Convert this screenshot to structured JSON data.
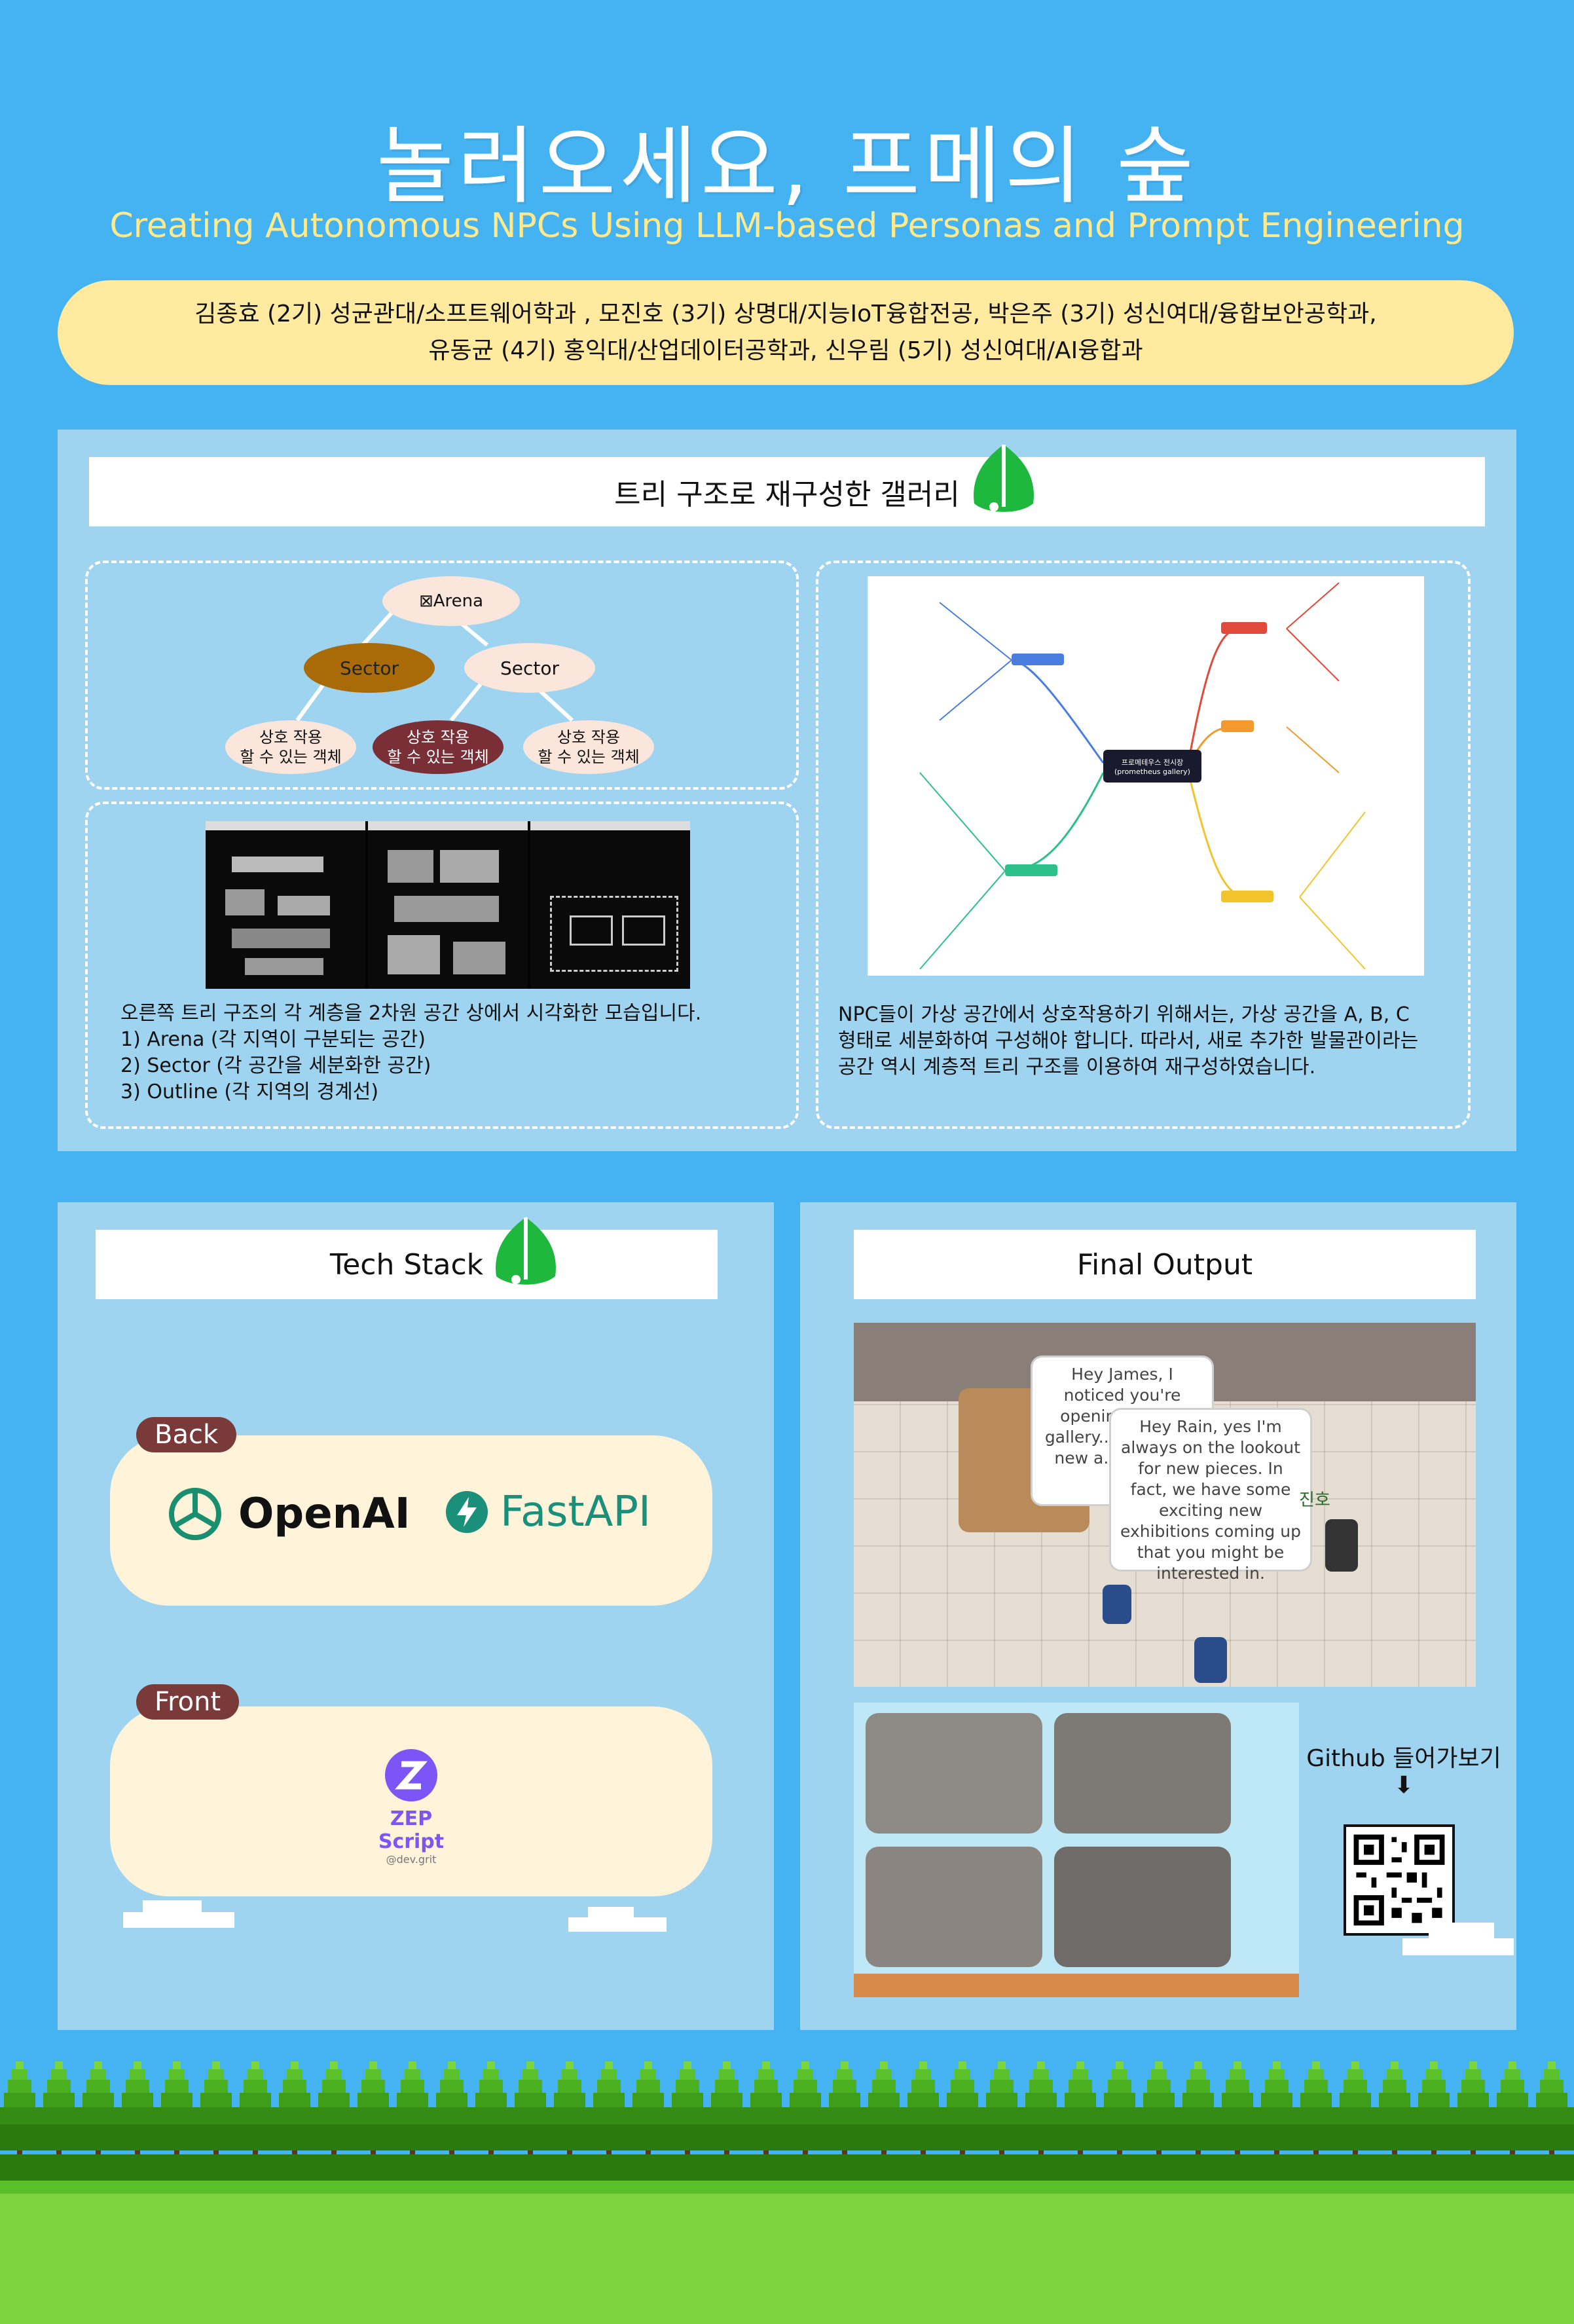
{
  "header": {
    "title": "놀러오세요, 프메의 숲",
    "subtitle": "Creating Autonomous NPCs Using LLM-based Personas and Prompt Engineering",
    "authors_line1": "김종효 (2기) 성균관대/소프트웨어학과 , 모진호 (3기) 상명대/지능IoT융합전공, 박은주 (3기) 성신여대/융합보안공학과,",
    "authors_line2": "유동균 (4기) 홍익대/산업데이터공학과, 신우림 (5기) 성신여대/AI융합과"
  },
  "gallery": {
    "title": "트리 구조로 재구성한 갤러리",
    "tree": {
      "root": "⊠Arena",
      "sector1": "Sector",
      "sector2": "Sector",
      "object1": "상호 작용\n할 수 있는 객체",
      "object2": "상호 작용\n할 수 있는 객체",
      "object3": "상호 작용\n할 수 있는 객체"
    },
    "left_caption": {
      "line1": "오른쪽 트리 구조의 각 계층을 2차원 공간 상에서 시각화한 모습입니다.",
      "line2": "1) Arena (각 지역이 구분되는 공간)",
      "line3": "2) Sector (각 공간을 세분화한 공간)",
      "line4": "3) Outline (각 지역의 경계선)"
    },
    "mindmap_center_line1": "프로메테우스 전시장",
    "mindmap_center_line2": "(prometheus gallery)",
    "right_caption": {
      "line1": "NPC들이 가상 공간에서 상호작용하기 위해서는, 가상 공간을 A, B, C",
      "line2": "형태로 세분화하여 구성해야 합니다. 따라서, 새로 추가한 발물관이라는",
      "line3": "공간 역시 계층적 트리 구조를 이용하여 재구성하였습니다."
    }
  },
  "tech": {
    "title": "Tech Stack",
    "back_label": "Back",
    "openai": "OpenAI",
    "fastapi": "FastAPI",
    "front_label": "Front",
    "zep": "ZEP Script",
    "zep_sub": "@dev.grit"
  },
  "output": {
    "title": "Final Output",
    "bubble1": "Hey James, I noticed you're opening up the gallery... you con... new a... caugh...",
    "bubble2": "Hey Rain, yes I'm always on the lookout for new pieces. In fact, we have some exciting new exhibitions coming up that you might be interested in.",
    "npc_name": "진호",
    "github_label": "Github 들어가보기",
    "arrow": "⬇"
  },
  "colors": {
    "sky": "#45b3f2",
    "panel": "#9fd4f1",
    "authors_bg": "#ffeaa0",
    "subtitle": "#ffe98a",
    "tag": "#7a3a3a",
    "leaf": "#1fb83f",
    "sector_dark": "#a86b08",
    "object_dark": "#7a2f36"
  }
}
